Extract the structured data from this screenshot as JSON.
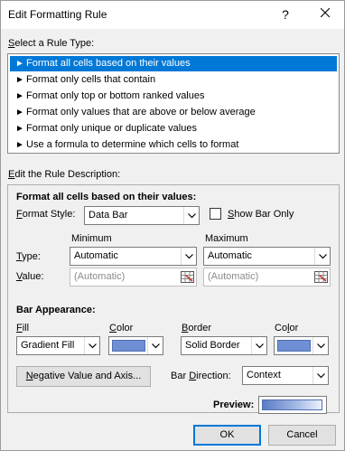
{
  "dialog": {
    "title": "Edit Formatting Rule",
    "help_glyph": "?",
    "close_glyph": "✕"
  },
  "ruletype": {
    "heading_first": "S",
    "heading_rest": "elect a Rule Type:",
    "items": [
      {
        "label": "Format all cells based on their values",
        "selected": true
      },
      {
        "label": "Format only cells that contain"
      },
      {
        "label": "Format only top or bottom ranked values"
      },
      {
        "label": "Format only values that are above or below average"
      },
      {
        "label": "Format only unique or duplicate values"
      },
      {
        "label": "Use a formula to determine which cells to format"
      }
    ]
  },
  "description": {
    "heading_first": "E",
    "heading_rest": "dit the Rule Description:",
    "section_title": "Format all cells based on their values:",
    "format_style_label_first": "F",
    "format_style_label_rest": "ormat Style:",
    "format_style_value": "Data Bar",
    "show_bar_only_first": "S",
    "show_bar_only_rest": "how Bar Only",
    "show_bar_only_checked": false,
    "minimum_header": "Minimum",
    "maximum_header": "Maximum",
    "type_label_first": "T",
    "type_label_rest": "ype:",
    "value_label_first": "V",
    "value_label_rest": "alue:",
    "min_type": "Automatic",
    "max_type": "Automatic",
    "min_value": "(Automatic)",
    "max_value": "(Automatic)",
    "bar_appearance_title": "Bar Appearance:",
    "fill_label_first": "F",
    "fill_label_rest": "ill",
    "color_label_1_first": "C",
    "color_label_1_rest": "olor",
    "border_label_first": "B",
    "border_label_rest": "order",
    "color_label_2_first": "C",
    "color_label_2_rest": "o",
    "color_label_2_u": "l",
    "color_label_2_end": "or",
    "fill_value": "Gradient Fill",
    "fill_color": "#6f8fd4",
    "border_value": "Solid Border",
    "border_color": "#6f8fd4",
    "negative_button_first": "N",
    "negative_button_rest": "egative Value and Axis...",
    "bar_direction_label_a": "Bar ",
    "bar_direction_label_u": "D",
    "bar_direction_label_b": "irection:",
    "bar_direction_value": "Context",
    "preview_label": "Preview:"
  },
  "footer": {
    "ok_label": "OK",
    "cancel_label": "Cancel"
  }
}
